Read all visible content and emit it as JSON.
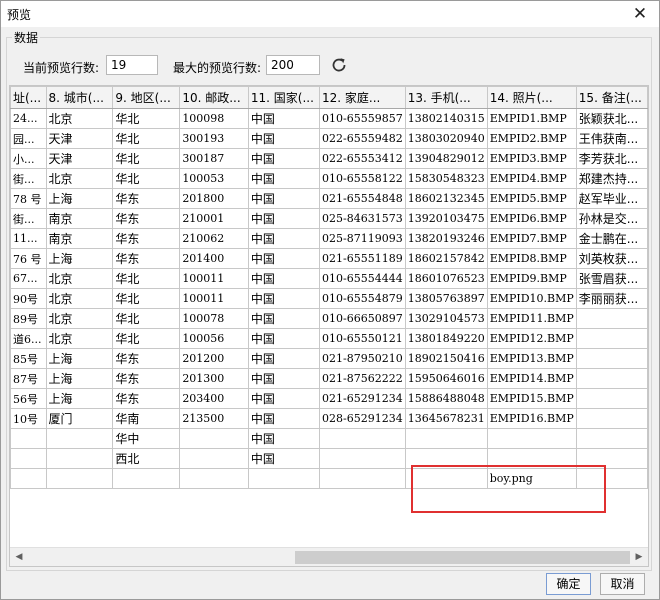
{
  "dialog": {
    "title": "预览",
    "close_glyph": "✕",
    "group_title": "数据",
    "current_rows_label": "当前预览行数:",
    "current_rows_value": "19",
    "max_rows_label": "最大的预览行数:",
    "max_rows_value": "200",
    "ok_label": "确定",
    "cancel_label": "取消"
  },
  "table": {
    "headers": [
      "址(...",
      "8. 城市(...",
      "9. 地区(...",
      "10. 邮政...",
      "11. 国家(...",
      "12. 家庭...",
      "13. 手机(...",
      "14. 照片(...",
      "15. 备注(..."
    ],
    "rows": [
      [
        "24...",
        "北京",
        "华北",
        "100098",
        "中国",
        "010-65559857",
        "13802140315",
        "EMPID1.BMP",
        "张颖获北..."
      ],
      [
        "园...",
        "天津",
        "华北",
        "300193",
        "中国",
        "022-65559482",
        "13803020940",
        "EMPID2.BMP",
        "王伟获南..."
      ],
      [
        "小...",
        "天津",
        "华北",
        "300187",
        "中国",
        "022-65553412",
        "13904829012",
        "EMPID3.BMP",
        "李芳获北..."
      ],
      [
        "街...",
        "北京",
        "华北",
        "100053",
        "中国",
        "010-65558122",
        "15830548323",
        "EMPID4.BMP",
        "郑建杰持..."
      ],
      [
        "78 号",
        "上海",
        "华东",
        "201800",
        "中国",
        "021-65554848",
        "18602132345",
        "EMPID5.BMP",
        "赵军毕业..."
      ],
      [
        "街...",
        "南京",
        "华东",
        "210001",
        "中国",
        "025-84631573",
        "13920103475",
        "EMPID6.BMP",
        "孙林是交..."
      ],
      [
        "11...",
        "南京",
        "华东",
        "210062",
        "中国",
        "025-87119093",
        "13820193246",
        "EMPID7.BMP",
        "金士鹏在..."
      ],
      [
        "76 号",
        "上海",
        "华东",
        "201400",
        "中国",
        "021-65551189",
        "18602157842",
        "EMPID8.BMP",
        "刘英枚获..."
      ],
      [
        "67...",
        "北京",
        "华北",
        "100011",
        "中国",
        "010-65554444",
        "18601076523",
        "EMPID9.BMP",
        "张雪眉获..."
      ],
      [
        "90号",
        "北京",
        "华北",
        "100011",
        "中国",
        "010-65554879",
        "13805763897",
        "EMPID10.BMP",
        "李丽丽获..."
      ],
      [
        "89号",
        "北京",
        "华北",
        "100078",
        "中国",
        "010-66650897",
        "13029104573",
        "EMPID11.BMP",
        ""
      ],
      [
        "道6...",
        "北京",
        "华北",
        "100056",
        "中国",
        "010-65550121",
        "13801849220",
        "EMPID12.BMP",
        ""
      ],
      [
        "85号",
        "上海",
        "华东",
        "201200",
        "中国",
        "021-87950210",
        "18902150416",
        "EMPID13.BMP",
        ""
      ],
      [
        "87号",
        "上海",
        "华东",
        "201300",
        "中国",
        "021-87562222",
        "15950646016",
        "EMPID14.BMP",
        ""
      ],
      [
        "56号",
        "上海",
        "华东",
        "203400",
        "中国",
        "021-65291234",
        "15886488048",
        "EMPID15.BMP",
        ""
      ],
      [
        "10号",
        "厦门",
        "华南",
        "213500",
        "中国",
        "028-65291234",
        "13645678231",
        "EMPID16.BMP",
        ""
      ],
      [
        "",
        "",
        "华中",
        "",
        "中国",
        "",
        "",
        "",
        ""
      ],
      [
        "",
        "",
        "西北",
        "",
        "中国",
        "",
        "",
        "",
        ""
      ],
      [
        "",
        "",
        "",
        "",
        "",
        "",
        "",
        "boy.png",
        ""
      ]
    ]
  },
  "highlight_color": "#e03030"
}
